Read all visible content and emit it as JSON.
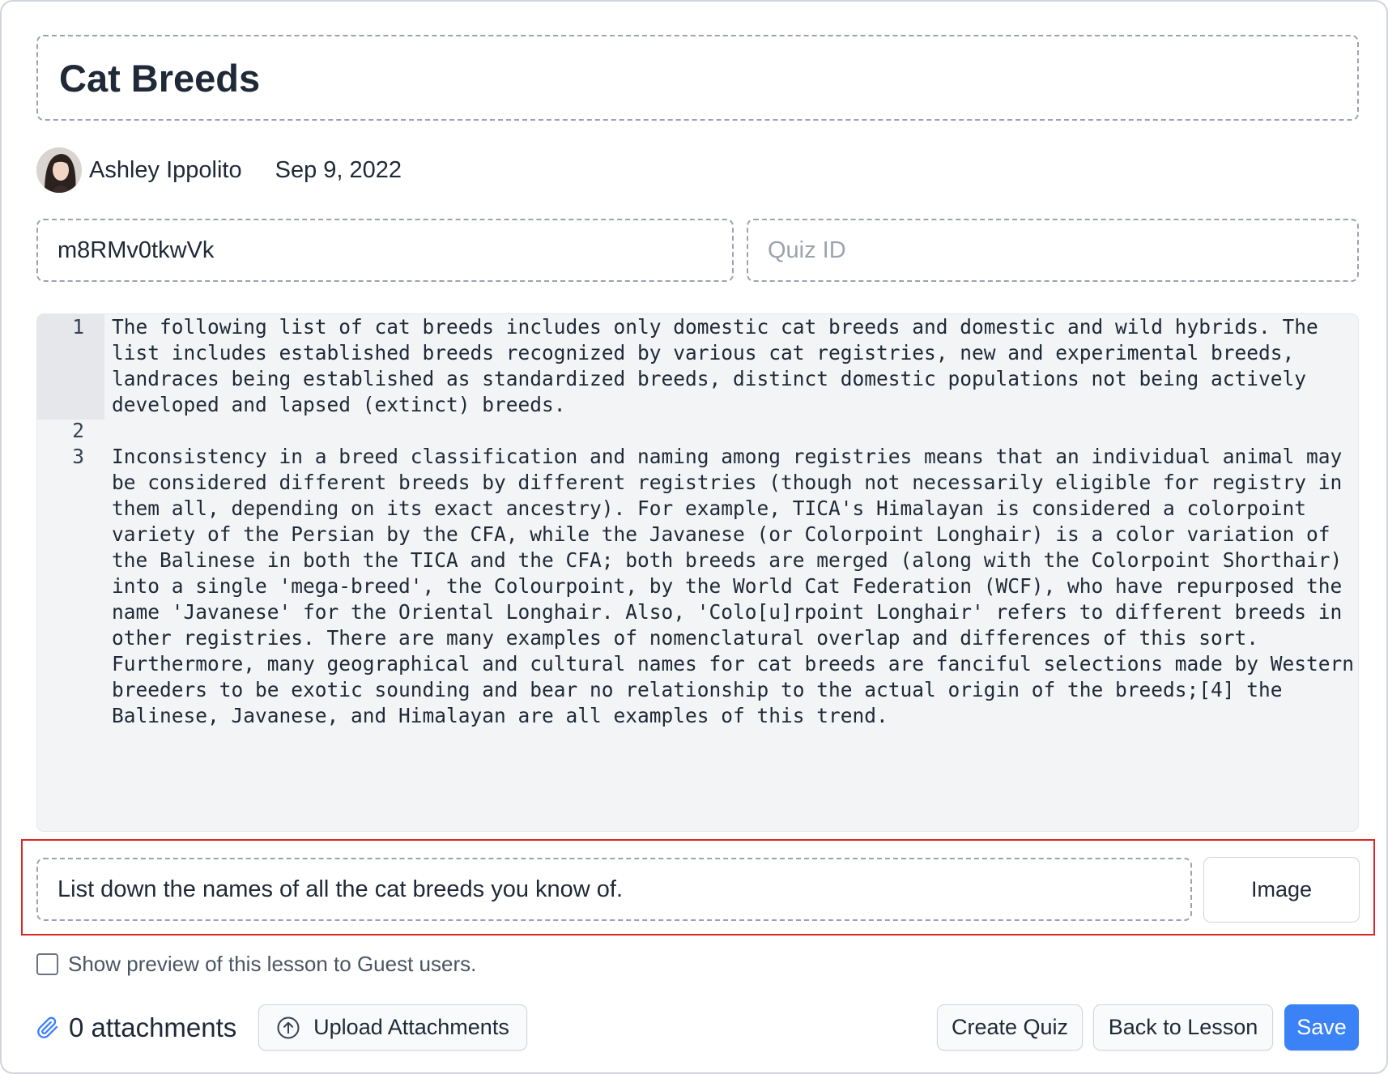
{
  "lesson": {
    "title": "Cat Breeds",
    "author": "Ashley Ippolito",
    "date": "Sep 9, 2022",
    "video_id": "m8RMv0tkwVk",
    "quiz_id_placeholder": "Quiz ID"
  },
  "editor": {
    "lines": [
      {
        "number": "1",
        "text": "The following list of cat breeds includes only domestic cat breeds and domestic and wild hybrids. The list includes established breeds recognized by various cat registries, new and experimental breeds, landraces being established as standardized breeds, distinct domestic populations not being actively developed and lapsed (extinct) breeds."
      },
      {
        "number": "2",
        "text": ""
      },
      {
        "number": "3",
        "text": "Inconsistency in a breed classification and naming among registries means that an individual animal may be considered different breeds by different registries (though not necessarily eligible for registry in them all, depending on its exact ancestry). For example, TICA's Himalayan is considered a colorpoint variety of the Persian by the CFA, while the Javanese (or Colorpoint Longhair) is a color variation of the Balinese in both the TICA and the CFA; both breeds are merged (along with the Colorpoint Shorthair) into a single 'mega-breed', the Colourpoint, by the World Cat Federation (WCF), who have repurposed the name 'Javanese' for the Oriental Longhair. Also, 'Colo[u]rpoint Longhair' refers to different breeds in other registries. There are many examples of nomenclatural overlap and differences of this sort. Furthermore, many geographical and cultural names for cat breeds are fanciful selections made by Western breeders to be exotic sounding and bear no relationship to the actual origin of the breeds;[4] the Balinese, Javanese, and Himalayan are all examples of this trend."
      }
    ]
  },
  "prompt": {
    "value": "List down the names of all the cat breeds you know of.",
    "image_button": "Image"
  },
  "preview": {
    "label": "Show preview of this lesson to Guest users.",
    "checked": false
  },
  "attachments": {
    "count_label": "0 attachments",
    "upload_button": "Upload Attachments"
  },
  "actions": {
    "create_quiz": "Create Quiz",
    "back_to_lesson": "Back to Lesson",
    "save": "Save"
  },
  "colors": {
    "primary": "#3b82f6",
    "highlight_outline": "#dc2626",
    "editor_bg": "#f3f4f6"
  },
  "icons": {
    "attachment": "paperclip-icon",
    "upload": "upload-arrow-circle-icon"
  }
}
